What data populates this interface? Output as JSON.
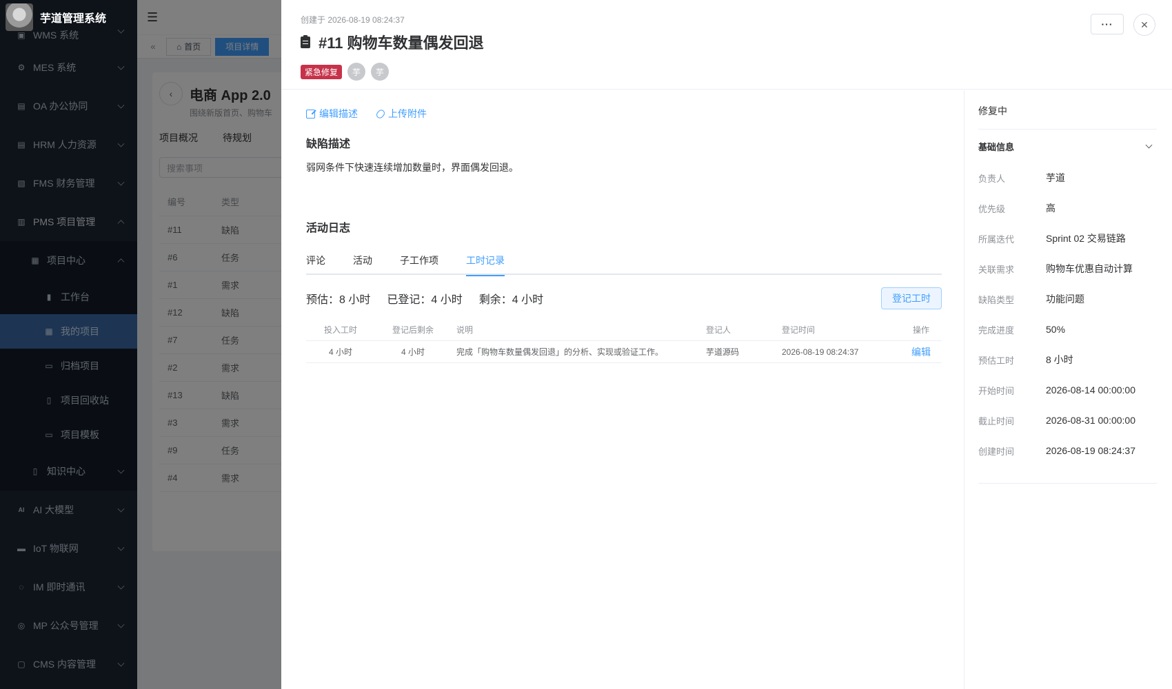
{
  "app": {
    "title": "芋道管理系统"
  },
  "sidebar": {
    "top_partial": "WMS 系统",
    "items": [
      {
        "label": "MES 系统",
        "icon": "gear-icon"
      },
      {
        "label": "OA 办公协同",
        "icon": "building-icon"
      },
      {
        "label": "HRM 人力资源",
        "icon": "building-icon"
      },
      {
        "label": "FMS 财务管理",
        "icon": "money-icon"
      },
      {
        "label": "PMS 项目管理",
        "icon": "chart-icon"
      }
    ],
    "pms_group": {
      "label": "项目中心",
      "icon": "grid-icon"
    },
    "pms_children": [
      {
        "label": "工作台",
        "icon": "clipboard-icon"
      },
      {
        "label": "我的项目",
        "icon": "grid-icon"
      },
      {
        "label": "归档项目",
        "icon": "archive-icon"
      },
      {
        "label": "项目回收站",
        "icon": "trash-icon"
      },
      {
        "label": "项目模板",
        "icon": "template-icon"
      }
    ],
    "knowledge": {
      "label": "知识中心",
      "icon": "book-icon"
    },
    "bottom_items": [
      {
        "label": "AI 大模型",
        "icon": "ai-icon"
      },
      {
        "label": "IoT 物联网",
        "icon": "server-icon"
      },
      {
        "label": "IM 即时通讯",
        "icon": "chat-icon"
      },
      {
        "label": "MP 公众号管理",
        "icon": "compass-icon"
      },
      {
        "label": "CMS 内容管理",
        "icon": "file-icon"
      }
    ]
  },
  "tagsbar": {
    "home": "首页",
    "current": "项目详情"
  },
  "project": {
    "title": "电商 App 2.0",
    "desc": "围绕新版首页、购物车",
    "tabs": [
      "项目概况",
      "待规划"
    ],
    "search_placeholder": "搜索事项",
    "columns": [
      "编号",
      "类型"
    ],
    "rows": [
      [
        "#11",
        "缺陷"
      ],
      [
        "#6",
        "任务"
      ],
      [
        "#1",
        "需求"
      ],
      [
        "#12",
        "缺陷"
      ],
      [
        "#7",
        "任务"
      ],
      [
        "#2",
        "需求"
      ],
      [
        "#13",
        "缺陷"
      ],
      [
        "#3",
        "需求"
      ],
      [
        "#9",
        "任务"
      ],
      [
        "#4",
        "需求"
      ]
    ]
  },
  "drawer": {
    "created": "创建于 2026-08-19 08:24:37",
    "title": "#11 购物车数量偶发回退",
    "urgent_tag": "紧急修复",
    "avatars": [
      "芋",
      "芋"
    ],
    "more_label": "···",
    "actions": {
      "edit_desc": "编辑描述",
      "upload": "上传附件"
    },
    "defect_title": "缺陷描述",
    "defect_text": "弱网条件下快速连续增加数量时，界面偶发回退。",
    "activity_title": "活动日志",
    "tabs": [
      "评论",
      "活动",
      "子工作项",
      "工时记录"
    ],
    "active_tab": "工时记录",
    "stats": {
      "estimated": "预估：8 小时",
      "logged": "已登记：4 小时",
      "remaining": "剩余：4 小时"
    },
    "log_button": "登记工时",
    "worklog": {
      "columns": [
        "投入工时",
        "登记后剩余",
        "说明",
        "登记人",
        "登记时间",
        "操作"
      ],
      "rows": [
        {
          "spent": "4 小时",
          "remaining": "4 小时",
          "note": "完成「购物车数量偶发回退」的分析、实现或验证工作。",
          "user": "芋道源码",
          "time": "2026-08-19 08:24:37",
          "action": "编辑"
        }
      ]
    },
    "status": "修复中",
    "basic_title": "基础信息",
    "info": [
      {
        "label": "负责人",
        "value": "芋道"
      },
      {
        "label": "优先级",
        "value": "高"
      },
      {
        "label": "所属迭代",
        "value": "Sprint 02 交易链路"
      },
      {
        "label": "关联需求",
        "value": "购物车优惠自动计算"
      },
      {
        "label": "缺陷类型",
        "value": "功能问题"
      },
      {
        "label": "完成进度",
        "value": "50%"
      },
      {
        "label": "预估工时",
        "value": "8 小时"
      },
      {
        "label": "开始时间",
        "value": "2026-08-14 00:00:00"
      },
      {
        "label": "截止时间",
        "value": "2026-08-31 00:00:00"
      },
      {
        "label": "创建时间",
        "value": "2026-08-19 08:24:37"
      }
    ]
  },
  "colors": {
    "primary": "#409eff",
    "sidebar_bg": "#1c2633",
    "active_menu": "#3b6ba6",
    "urgent": "#c7324a"
  }
}
